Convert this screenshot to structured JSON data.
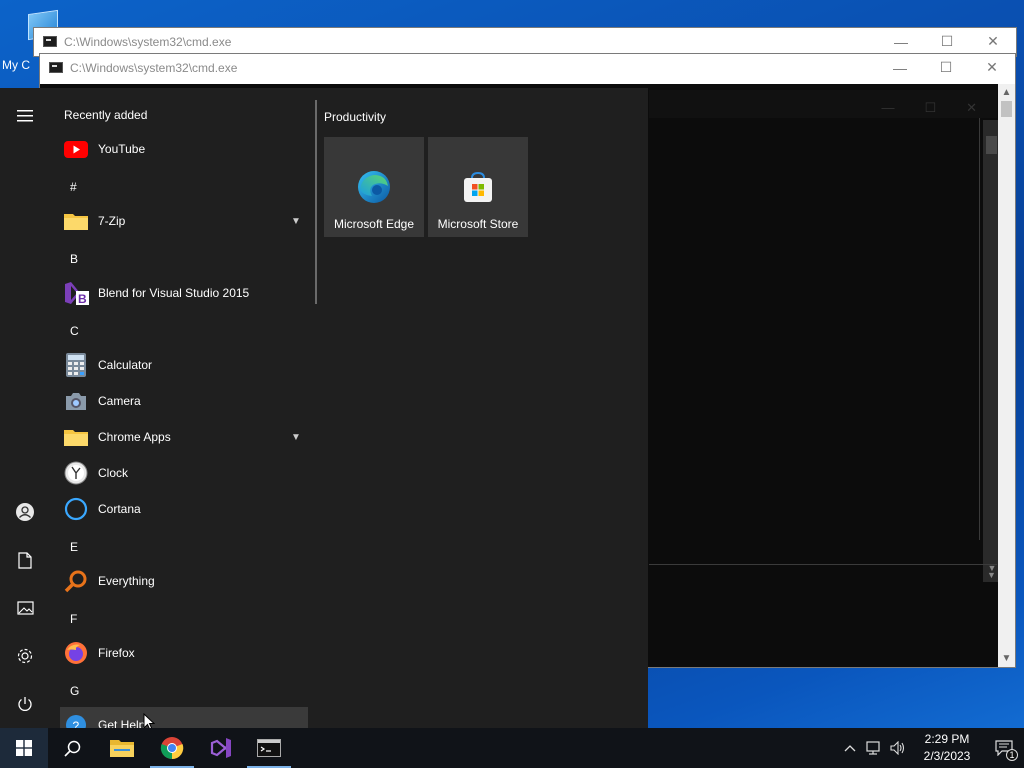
{
  "desktop": {
    "icon_label": "My C"
  },
  "cmd_windows": [
    {
      "title": "C:\\Windows\\system32\\cmd.exe"
    },
    {
      "title": "C:\\Windows\\system32\\cmd.exe"
    }
  ],
  "window_controls": {
    "minimize": "—",
    "maximize": "☐",
    "close": "✕"
  },
  "start_menu": {
    "recently_added_label": "Recently added",
    "apps": [
      {
        "type": "app",
        "name": "YouTube",
        "icon": "youtube-icon"
      },
      {
        "type": "letter",
        "name": "#"
      },
      {
        "type": "folder",
        "name": "7-Zip",
        "icon": "folder-icon"
      },
      {
        "type": "letter",
        "name": "B"
      },
      {
        "type": "app",
        "name": "Blend for Visual Studio 2015",
        "icon": "blend-icon"
      },
      {
        "type": "letter",
        "name": "C"
      },
      {
        "type": "app",
        "name": "Calculator",
        "icon": "calculator-icon"
      },
      {
        "type": "app",
        "name": "Camera",
        "icon": "camera-icon"
      },
      {
        "type": "folder",
        "name": "Chrome Apps",
        "icon": "folder-icon"
      },
      {
        "type": "app",
        "name": "Clock",
        "icon": "clock-icon"
      },
      {
        "type": "app",
        "name": "Cortana",
        "icon": "cortana-icon"
      },
      {
        "type": "letter",
        "name": "E"
      },
      {
        "type": "app",
        "name": "Everything",
        "icon": "everything-icon"
      },
      {
        "type": "letter",
        "name": "F"
      },
      {
        "type": "app",
        "name": "Firefox",
        "icon": "firefox-icon"
      },
      {
        "type": "letter",
        "name": "G"
      },
      {
        "type": "app",
        "name": "Get Help",
        "icon": "get-help-icon"
      }
    ],
    "tile_group": "Productivity",
    "tiles": [
      {
        "name": "Microsoft Edge",
        "icon": "edge-icon"
      },
      {
        "name": "Microsoft Store",
        "icon": "store-icon"
      }
    ]
  },
  "taskbar": {
    "clock_time": "2:29 PM",
    "clock_date": "2/3/2023",
    "notification_count": "1",
    "pinned": [
      "search-icon",
      "file-explorer-icon",
      "chrome-icon",
      "visual-studio-icon",
      "cmd-icon"
    ]
  }
}
